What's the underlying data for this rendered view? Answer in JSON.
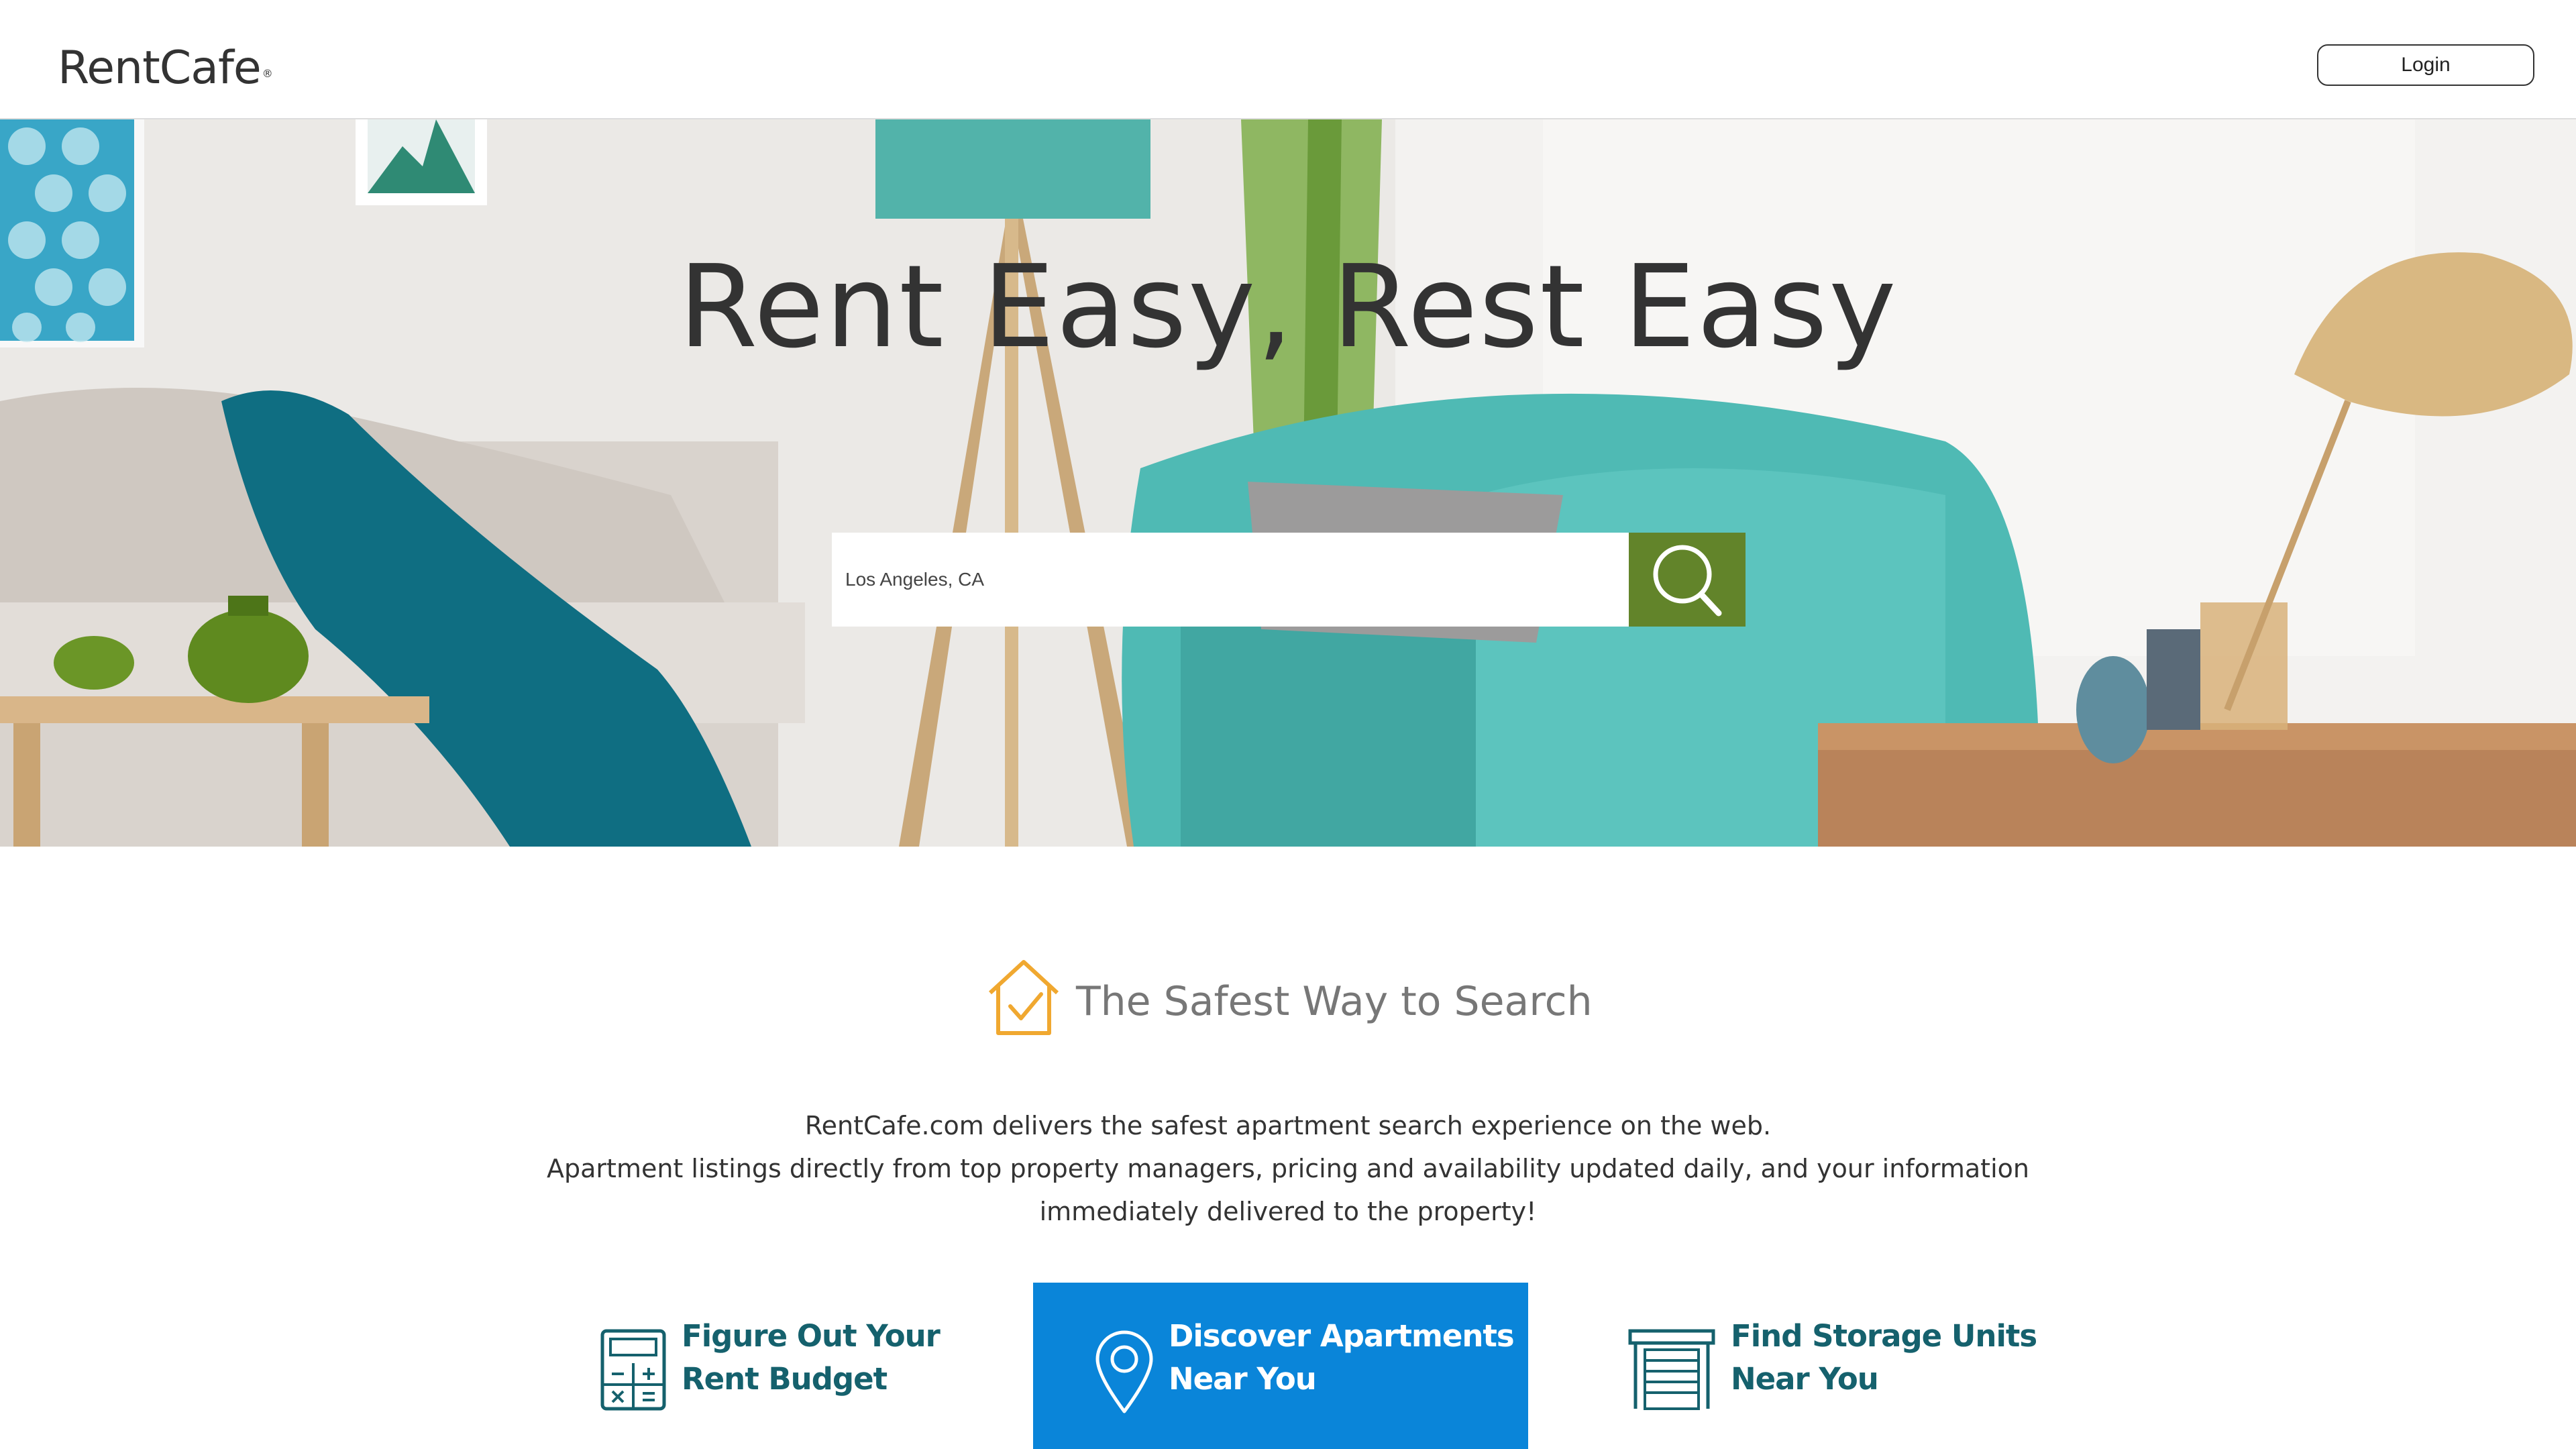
{
  "header": {
    "logo_text": "RentCafe",
    "logo_mark": "®",
    "login_label": "Login"
  },
  "hero": {
    "title": "Rent Easy, Rest Easy",
    "search": {
      "value": "Los Angeles, CA",
      "icon": "search-icon",
      "button_color": "#62842a"
    }
  },
  "safe": {
    "icon": "house-check-icon",
    "title": "The Safest Way to Search",
    "lines": [
      "RentCafe.com delivers the safest apartment search experience on the web.",
      "Apartment listings directly from top property managers, pricing and availability updated daily, and your information",
      "immediately delivered to the property!"
    ]
  },
  "features": [
    {
      "icon": "calculator-icon",
      "line1": "Figure Out Your",
      "line2": "Rent Budget"
    },
    {
      "icon": "map-pin-icon",
      "line1": "Discover Apartments",
      "line2": "Near You",
      "active_color": "#0a85d9"
    },
    {
      "icon": "storage-unit-icon",
      "line1": "Find Storage Units",
      "line2": "Near You"
    }
  ],
  "colors": {
    "accent_teal": "#15616d",
    "safe_icon": "#f0a830",
    "search_green": "#62842a",
    "feature_blue": "#0a85d9"
  }
}
